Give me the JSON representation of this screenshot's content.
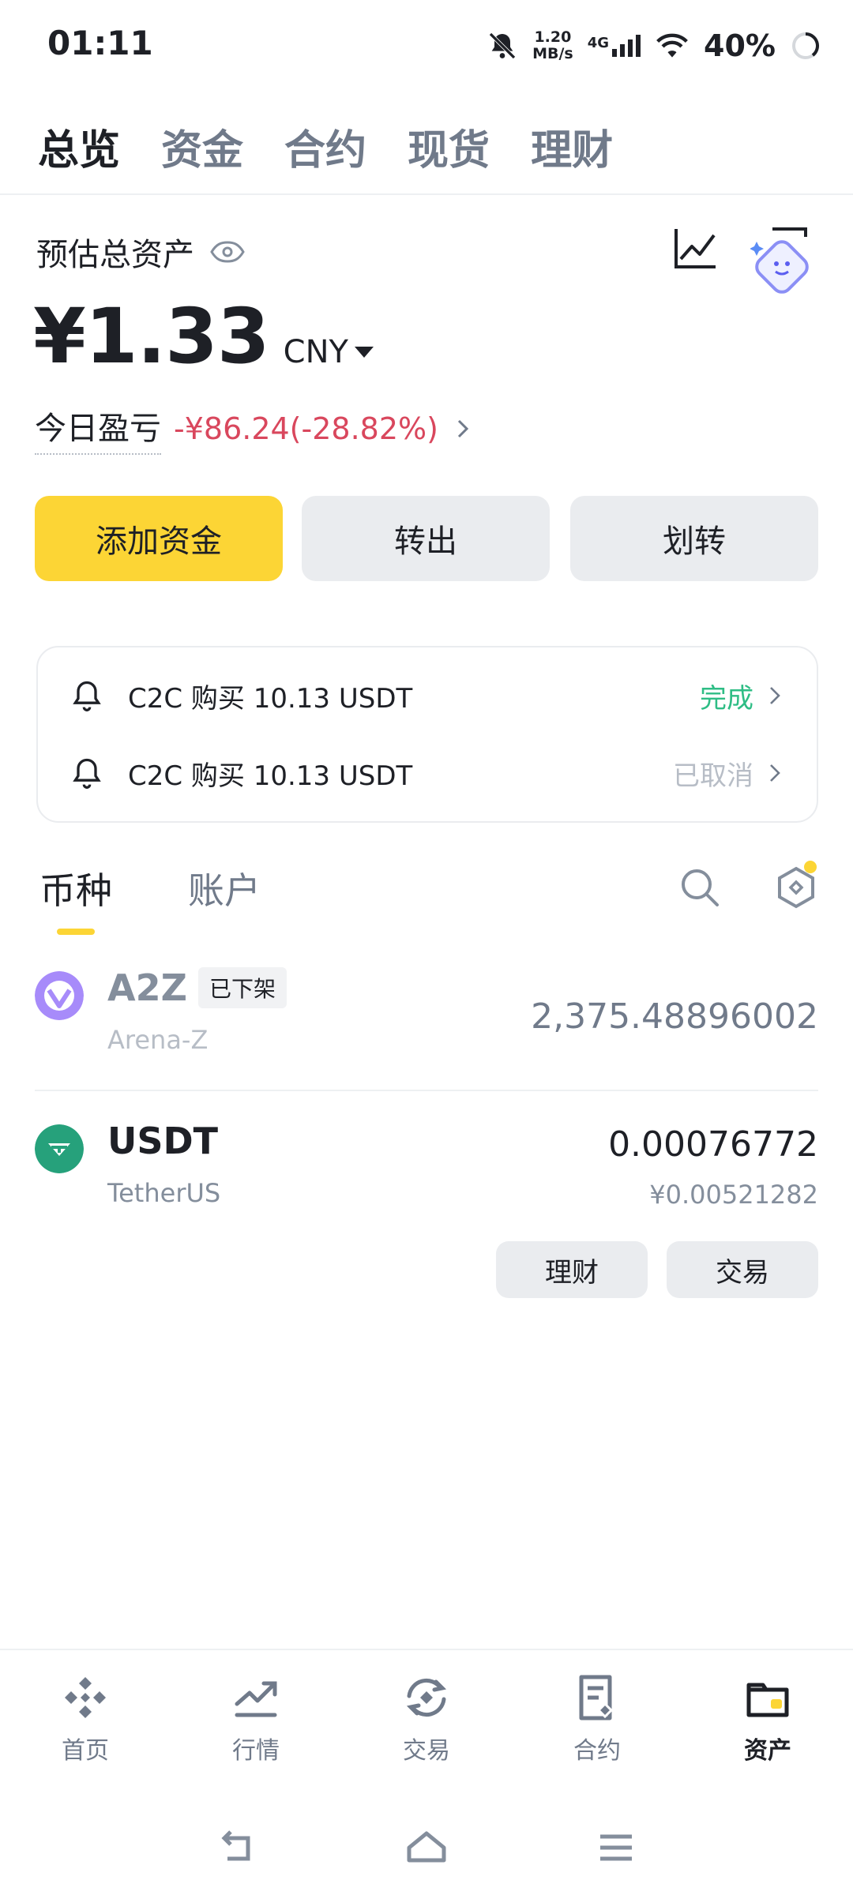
{
  "status_bar": {
    "time": "01:11",
    "net_speed_value": "1.20",
    "net_speed_unit": "MB/s",
    "network": "4G",
    "battery": "40%"
  },
  "top_tabs": [
    {
      "label": "总览",
      "active": true
    },
    {
      "label": "资金",
      "active": false
    },
    {
      "label": "合约",
      "active": false
    },
    {
      "label": "现货",
      "active": false
    },
    {
      "label": "理财",
      "active": false
    }
  ],
  "overview": {
    "estimated_label": "预估总资产",
    "total_value": "¥1.33",
    "currency": "CNY",
    "pnl_label": "今日盈亏",
    "pnl_value": "-¥86.24(-28.82%)"
  },
  "actions": {
    "add_funds": "添加资金",
    "withdraw": "转出",
    "transfer": "划转"
  },
  "notifications": [
    {
      "text": "C2C 购买 10.13 USDT",
      "status": "完成",
      "status_color": "#2ebd85"
    },
    {
      "text": "C2C 购买 10.13 USDT",
      "status": "已取消",
      "status_color": "#b7bdc6"
    }
  ],
  "sub_tabs": {
    "coins": "币种",
    "accounts": "账户"
  },
  "assets": [
    {
      "symbol": "A2Z",
      "badge": "已下架",
      "name": "Arena-Z",
      "amount": "2,375.48896002",
      "logo_color": "#a78bfa"
    },
    {
      "symbol": "USDT",
      "name": "TetherUS",
      "amount": "0.00076772",
      "fiat": "¥0.00521282",
      "logo_color": "#26a17b",
      "buttons": {
        "earn": "理财",
        "trade": "交易"
      }
    }
  ],
  "bottom_nav": [
    {
      "label": "首页",
      "icon": "home-icon"
    },
    {
      "label": "行情",
      "icon": "markets-icon"
    },
    {
      "label": "交易",
      "icon": "trade-icon"
    },
    {
      "label": "合约",
      "icon": "futures-icon"
    },
    {
      "label": "资产",
      "icon": "wallet-icon",
      "active": true
    }
  ],
  "colors": {
    "accent": "#fcd535",
    "loss": "#d9475d",
    "success": "#2ebd85"
  }
}
